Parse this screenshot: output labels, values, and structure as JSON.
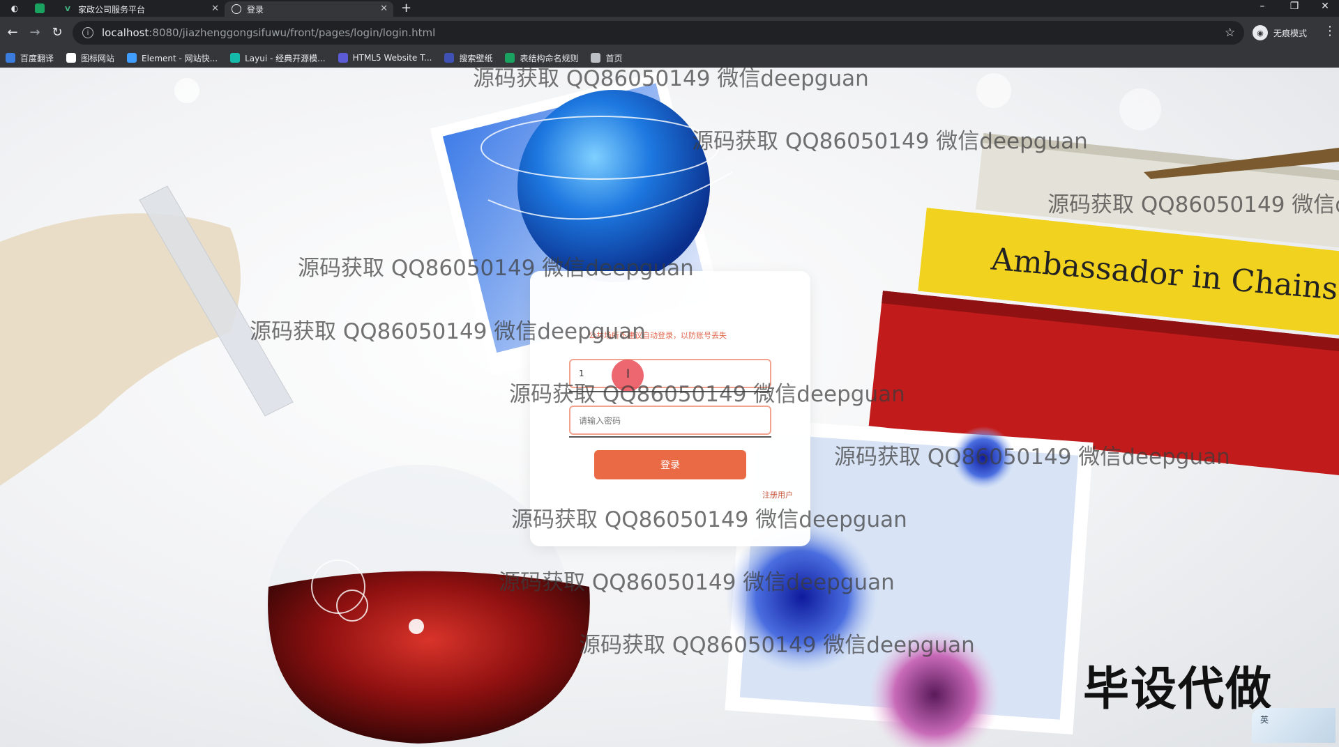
{
  "browser": {
    "tabs": [
      {
        "label": "家政公司服务平台",
        "active": false
      },
      {
        "label": "登录",
        "active": true
      }
    ],
    "url_host": "localhost",
    "url_path": ":8080/jiazhenggongsifuwu/front/pages/login/login.html",
    "incognito_label": "无痕模式",
    "bookmarks": [
      {
        "label": "百度翻译",
        "icon": "translate-icon",
        "color": "#3b7ddd"
      },
      {
        "label": "图标网站",
        "icon": "flag-icon",
        "color": "#ffffff"
      },
      {
        "label": "Element - 网站快...",
        "icon": "element-icon",
        "color": "#409eff"
      },
      {
        "label": "Layui - 经典开源模...",
        "icon": "layui-icon",
        "color": "#16baaa"
      },
      {
        "label": "HTML5 Website T...",
        "icon": "html5-icon",
        "color": "#5b5bd6"
      },
      {
        "label": "搜索壁纸",
        "icon": "wallpaper-icon",
        "color": "#3f51b5"
      },
      {
        "label": "表结构命名规则",
        "icon": "table-icon",
        "color": "#1aa260"
      },
      {
        "label": "首页",
        "icon": "globe-icon",
        "color": "#bdc1c6"
      }
    ]
  },
  "login": {
    "tip": "公共场所不建议自动登录，以防账号丢失",
    "username_value": "1",
    "password_placeholder": "请输入密码",
    "login_button": "登录",
    "register_link": "注册用户"
  },
  "watermark_text": "源码获取 QQ86050149 微信deepguan",
  "ad_text": "毕设代做",
  "ime_label": "英",
  "colors": {
    "accent": "#ea6a45",
    "input_border": "#f2a38f",
    "tip": "#e0684e"
  }
}
